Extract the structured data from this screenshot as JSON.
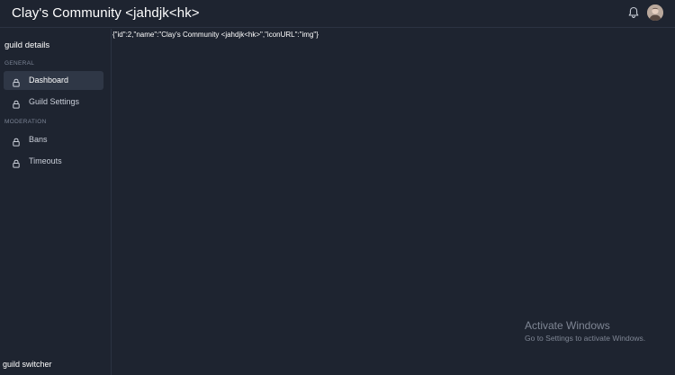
{
  "header": {
    "title": "Clay's Community <jahdjk<hk>",
    "notification_icon": "bell-icon",
    "avatar_icon": "user-avatar"
  },
  "sidebar": {
    "title": "guild details",
    "sections": [
      {
        "label": "GENERAL",
        "items": [
          {
            "label": "Dashboard",
            "icon": "lock-icon",
            "active": true
          },
          {
            "label": "Guild Settings",
            "icon": "lock-icon",
            "active": false
          }
        ]
      },
      {
        "label": "MODERATION",
        "items": [
          {
            "label": "Bans",
            "icon": "lock-icon",
            "active": false
          },
          {
            "label": "Timeouts",
            "icon": "lock-icon",
            "active": false
          }
        ]
      }
    ],
    "footer": "guild switcher"
  },
  "main": {
    "json_text": "{\"id\":2,\"name\":\"Clay's Community <jahdjk<hk>\",\"iconURL\":\"img\"}"
  },
  "watermark": {
    "title": "Activate Windows",
    "subtitle": "Go to Settings to activate Windows."
  },
  "colors": {
    "background": "#1e2430",
    "active_item": "#2f3746",
    "divider": "#2b3342"
  }
}
